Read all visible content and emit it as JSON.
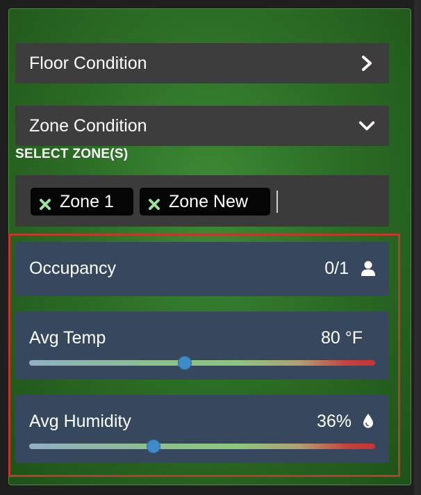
{
  "accordions": {
    "floor": {
      "label": "Floor Condition",
      "icon": "chevron-right-icon",
      "expanded": false
    },
    "zone": {
      "label": "Zone Condition",
      "icon": "chevron-down-icon",
      "expanded": true
    }
  },
  "zone_select": {
    "label": "SELECT ZONE(S)",
    "chips": [
      {
        "label": "Zone 1",
        "icon": "remove-x-icon"
      },
      {
        "label": "Zone New",
        "icon": "remove-x-icon"
      }
    ]
  },
  "metrics": {
    "occupancy": {
      "label": "Occupancy",
      "value": "0/1",
      "icon": "person-icon"
    },
    "temp": {
      "label": "Avg Temp",
      "value": "80 °F",
      "slider_fraction": 0.45
    },
    "humidity": {
      "label": "Avg Humidity",
      "value": "36%",
      "icon": "water-drop-icon",
      "slider_fraction": 0.36
    }
  },
  "colors": {
    "panel_green": "#2c6e26",
    "accordion_bg": "#3d3d3d",
    "metric_bg": "#37485e",
    "chip_x": "#9fe09a",
    "highlight_border": "#c0392b",
    "slider_thumb": "#3f8ac9"
  }
}
